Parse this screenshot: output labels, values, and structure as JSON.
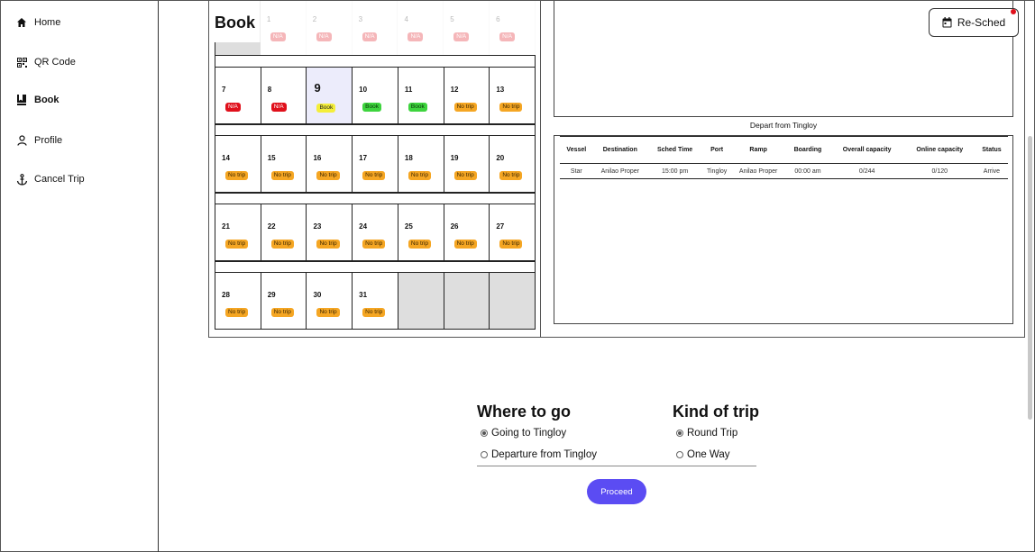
{
  "sidebar": {
    "items": [
      {
        "label": "Home",
        "icon": "home-icon"
      },
      {
        "label": "QR Code",
        "icon": "qr-icon"
      },
      {
        "label": "Book",
        "icon": "book-icon"
      },
      {
        "label": "Profile",
        "icon": "user-icon"
      },
      {
        "label": "Cancel Trip",
        "icon": "anchor-icon"
      }
    ]
  },
  "header": {
    "title": "Book",
    "resched_label": "Re-Sched"
  },
  "calendar": {
    "top_row": [
      {
        "num": "",
        "badge": ""
      },
      {
        "num": "1",
        "badge": "N/A"
      },
      {
        "num": "2",
        "badge": "N/A"
      },
      {
        "num": "3",
        "badge": "N/A"
      },
      {
        "num": "4",
        "badge": "N/A"
      },
      {
        "num": "5",
        "badge": "N/A"
      },
      {
        "num": "6",
        "badge": "N/A"
      }
    ],
    "weeks": [
      [
        {
          "num": "7",
          "badge": "N/A",
          "kind": "na"
        },
        {
          "num": "8",
          "badge": "N/A",
          "kind": "na"
        },
        {
          "num": "9",
          "badge": "Book",
          "kind": "book-yellow",
          "today": true
        },
        {
          "num": "10",
          "badge": "Book",
          "kind": "book-green"
        },
        {
          "num": "11",
          "badge": "Book",
          "kind": "book-green"
        },
        {
          "num": "12",
          "badge": "No trip",
          "kind": "notrip"
        },
        {
          "num": "13",
          "badge": "No trip",
          "kind": "notrip"
        }
      ],
      [
        {
          "num": "14",
          "badge": "No trip",
          "kind": "notrip"
        },
        {
          "num": "15",
          "badge": "No trip",
          "kind": "notrip"
        },
        {
          "num": "16",
          "badge": "No trip",
          "kind": "notrip"
        },
        {
          "num": "17",
          "badge": "No trip",
          "kind": "notrip"
        },
        {
          "num": "18",
          "badge": "No trip",
          "kind": "notrip"
        },
        {
          "num": "19",
          "badge": "No trip",
          "kind": "notrip"
        },
        {
          "num": "20",
          "badge": "No trip",
          "kind": "notrip"
        }
      ],
      [
        {
          "num": "21",
          "badge": "No trip",
          "kind": "notrip"
        },
        {
          "num": "22",
          "badge": "No trip",
          "kind": "notrip"
        },
        {
          "num": "23",
          "badge": "No trip",
          "kind": "notrip"
        },
        {
          "num": "24",
          "badge": "No trip",
          "kind": "notrip"
        },
        {
          "num": "25",
          "badge": "No trip",
          "kind": "notrip"
        },
        {
          "num": "26",
          "badge": "No trip",
          "kind": "notrip"
        },
        {
          "num": "27",
          "badge": "No trip",
          "kind": "notrip"
        }
      ],
      [
        {
          "num": "28",
          "badge": "No trip",
          "kind": "notrip"
        },
        {
          "num": "29",
          "badge": "No trip",
          "kind": "notrip"
        },
        {
          "num": "30",
          "badge": "No trip",
          "kind": "notrip"
        },
        {
          "num": "31",
          "badge": "No trip",
          "kind": "notrip"
        },
        {
          "num": "",
          "badge": "",
          "kind": "empty"
        },
        {
          "num": "",
          "badge": "",
          "kind": "empty"
        },
        {
          "num": "",
          "badge": "",
          "kind": "empty"
        }
      ]
    ]
  },
  "trips": {
    "title": "Depart from Tingloy",
    "headers": [
      "Vessel",
      "Destination",
      "Sched Time",
      "Port",
      "Ramp",
      "Boarding",
      "Overall capacity",
      "Online capacity",
      "Status"
    ],
    "rows": [
      [
        "Star",
        "Anilao Proper",
        "15:00 pm",
        "Tingloy",
        "Anilao Proper",
        "00:00 am",
        "0/244",
        "0/120",
        "Arrive"
      ]
    ]
  },
  "form": {
    "where_title": "Where to go",
    "where_options": [
      {
        "label": "Going to Tingloy",
        "checked": true
      },
      {
        "label": "Departure from Tingloy",
        "checked": false
      }
    ],
    "kind_title": "Kind of trip",
    "kind_options": [
      {
        "label": "Round Trip",
        "checked": true
      },
      {
        "label": "One Way",
        "checked": false
      }
    ],
    "proceed_label": "Proceed"
  }
}
